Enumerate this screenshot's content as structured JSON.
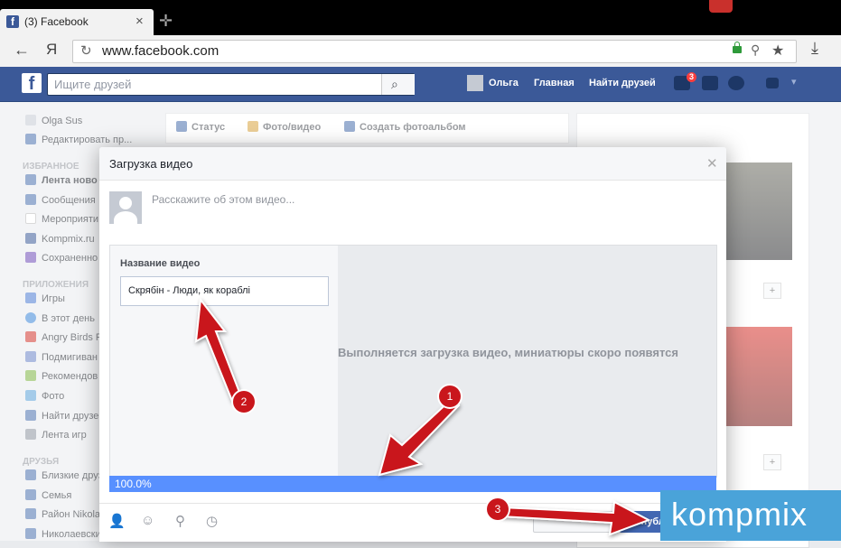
{
  "browser": {
    "tab_title": "(3) Facebook",
    "tab_favicon": "f",
    "yandex_letter": "Я",
    "url": "www.facebook.com"
  },
  "fb_header": {
    "logo": "f",
    "search_placeholder": "Ищите друзей",
    "user_name": "Ольга",
    "nav_home": "Главная",
    "nav_find_friends": "Найти друзей",
    "friend_requests_count": "3"
  },
  "left_nav": {
    "profile_name": "Olga Sus",
    "edit_profile": "Редактировать пр...",
    "section_favorites": "ИЗБРАННОЕ",
    "favorites": [
      "Лента ново",
      "Сообщения",
      "Мероприяти",
      "Kompmix.ru",
      "Сохраненно"
    ],
    "section_apps": "ПРИЛОЖЕНИЯ",
    "apps": [
      "Игры",
      "В этот день",
      "Angry Birds F",
      "Подмигиван",
      "Рекомендов",
      "Фото",
      "Найти друзе",
      "Лента игр"
    ],
    "section_friends": "ДРУЗЬЯ",
    "friends": [
      "Близкие друз",
      "Семья",
      "Район Nikola",
      "Николаевски"
    ]
  },
  "composer": {
    "tab_status": "Статус",
    "tab_photo_video": "Фото/видео",
    "tab_create_album": "Создать фотоальбом"
  },
  "dialog": {
    "title": "Загрузка видео",
    "description_placeholder": "Расскажите об этом видео...",
    "video_name_label": "Название видео",
    "video_name_value": "Скрябін - Люди, як кораблі",
    "upload_message": "Выполняется загрузка видео, миниатюры скоро появятся",
    "progress_text": "100.0%",
    "progress_fraction": 1.0,
    "publish_label": "Опубликовать"
  },
  "annotations": {
    "step1": "1",
    "step2": "2",
    "step3": "3",
    "arrow_color": "#c9161c"
  },
  "watermark": {
    "text": "kompmix",
    "color": "#4aa3d9"
  }
}
